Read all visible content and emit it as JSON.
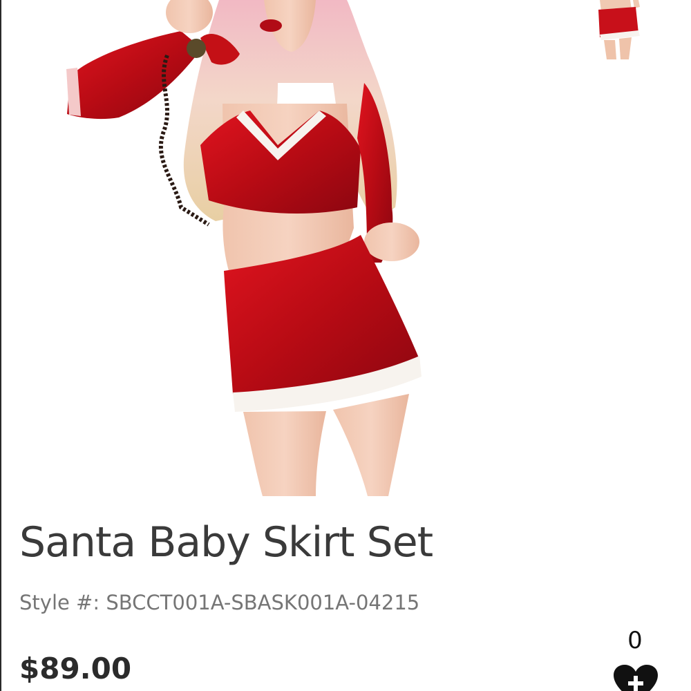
{
  "product": {
    "title": "Santa Baby Skirt Set",
    "style_label": "Style #:",
    "style_number": "SBCCT001A-SBASK001A-04215",
    "price": "$89.00"
  },
  "favorites": {
    "count": "0",
    "icon": "heart-plus-icon"
  },
  "colors": {
    "outfit_red": "#c8101a",
    "trim_white": "#f7f3ee",
    "title_text": "#3a3a3a",
    "muted_text": "#757575"
  }
}
